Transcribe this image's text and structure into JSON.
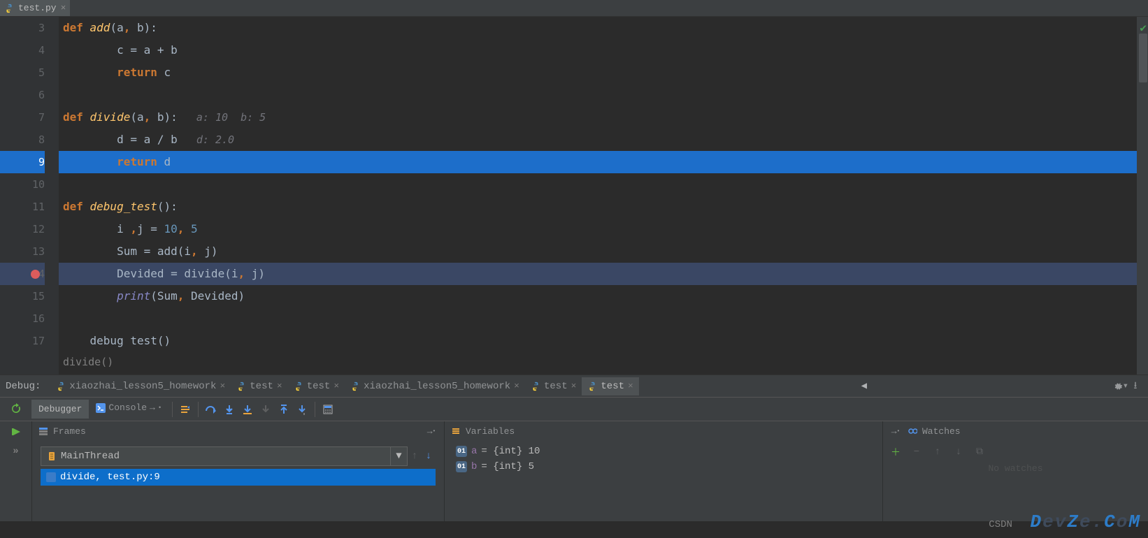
{
  "file_tab": {
    "name": "test.py"
  },
  "editor": {
    "lines": [
      {
        "n": 3,
        "kw": "def ",
        "fn": "add",
        "sig": "(a, b):"
      },
      {
        "n": 4,
        "indent": "        ",
        "body": "c = a + b"
      },
      {
        "n": 5,
        "indent": "        ",
        "kw": "return ",
        "rest": "c"
      },
      {
        "n": 6
      },
      {
        "n": 7,
        "kw": "def ",
        "fn": "divide",
        "sig": "(a, b):",
        "inlay": "   a: 10  b: 5"
      },
      {
        "n": 8,
        "indent": "        ",
        "body": "d = a / b",
        "inlay": "   d: 2.0"
      },
      {
        "n": 9,
        "hl": true,
        "indent": "        ",
        "kw": "return ",
        "rest": "d"
      },
      {
        "n": 10
      },
      {
        "n": 11,
        "kw": "def ",
        "fn": "debug_test",
        "sig": "():"
      },
      {
        "n": 12,
        "indent": "        ",
        "body": "i ,j = ",
        "nums": "10, 5"
      },
      {
        "n": 13,
        "indent": "        ",
        "body": "Sum = add(i, j)"
      },
      {
        "n": 14,
        "hl2": true,
        "bp": true,
        "indent": "        ",
        "body": "Devided = divide(i, j)"
      },
      {
        "n": 15,
        "indent": "        ",
        "builtin": "print",
        "rest": "(Sum, Devided)"
      },
      {
        "n": 16
      },
      {
        "n": 17,
        "body": "    debug test()"
      }
    ],
    "context": "divide()"
  },
  "debug": {
    "label": "Debug:",
    "tabs": [
      {
        "label": "xiaozhai_lesson5_homework",
        "active": false
      },
      {
        "label": "test",
        "active": false
      },
      {
        "label": "test",
        "active": false
      },
      {
        "label": "xiaozhai_lesson5_homework",
        "active": false
      },
      {
        "label": "test",
        "active": false
      },
      {
        "label": "test",
        "active": true
      }
    ],
    "debugger_tab": "Debugger",
    "console_tab": "Console"
  },
  "frames": {
    "title": "Frames",
    "thread": "MainThread",
    "frame": "divide, test.py:9"
  },
  "variables": {
    "title": "Variables",
    "items": [
      {
        "name": "a",
        "type": "{int}",
        "value": "10"
      },
      {
        "name": "b",
        "type": "{int}",
        "value": "5"
      }
    ]
  },
  "watches": {
    "title": "Watches",
    "empty": "No watches"
  },
  "watermark": "DevZe.CoM",
  "csdn": "CSDN"
}
